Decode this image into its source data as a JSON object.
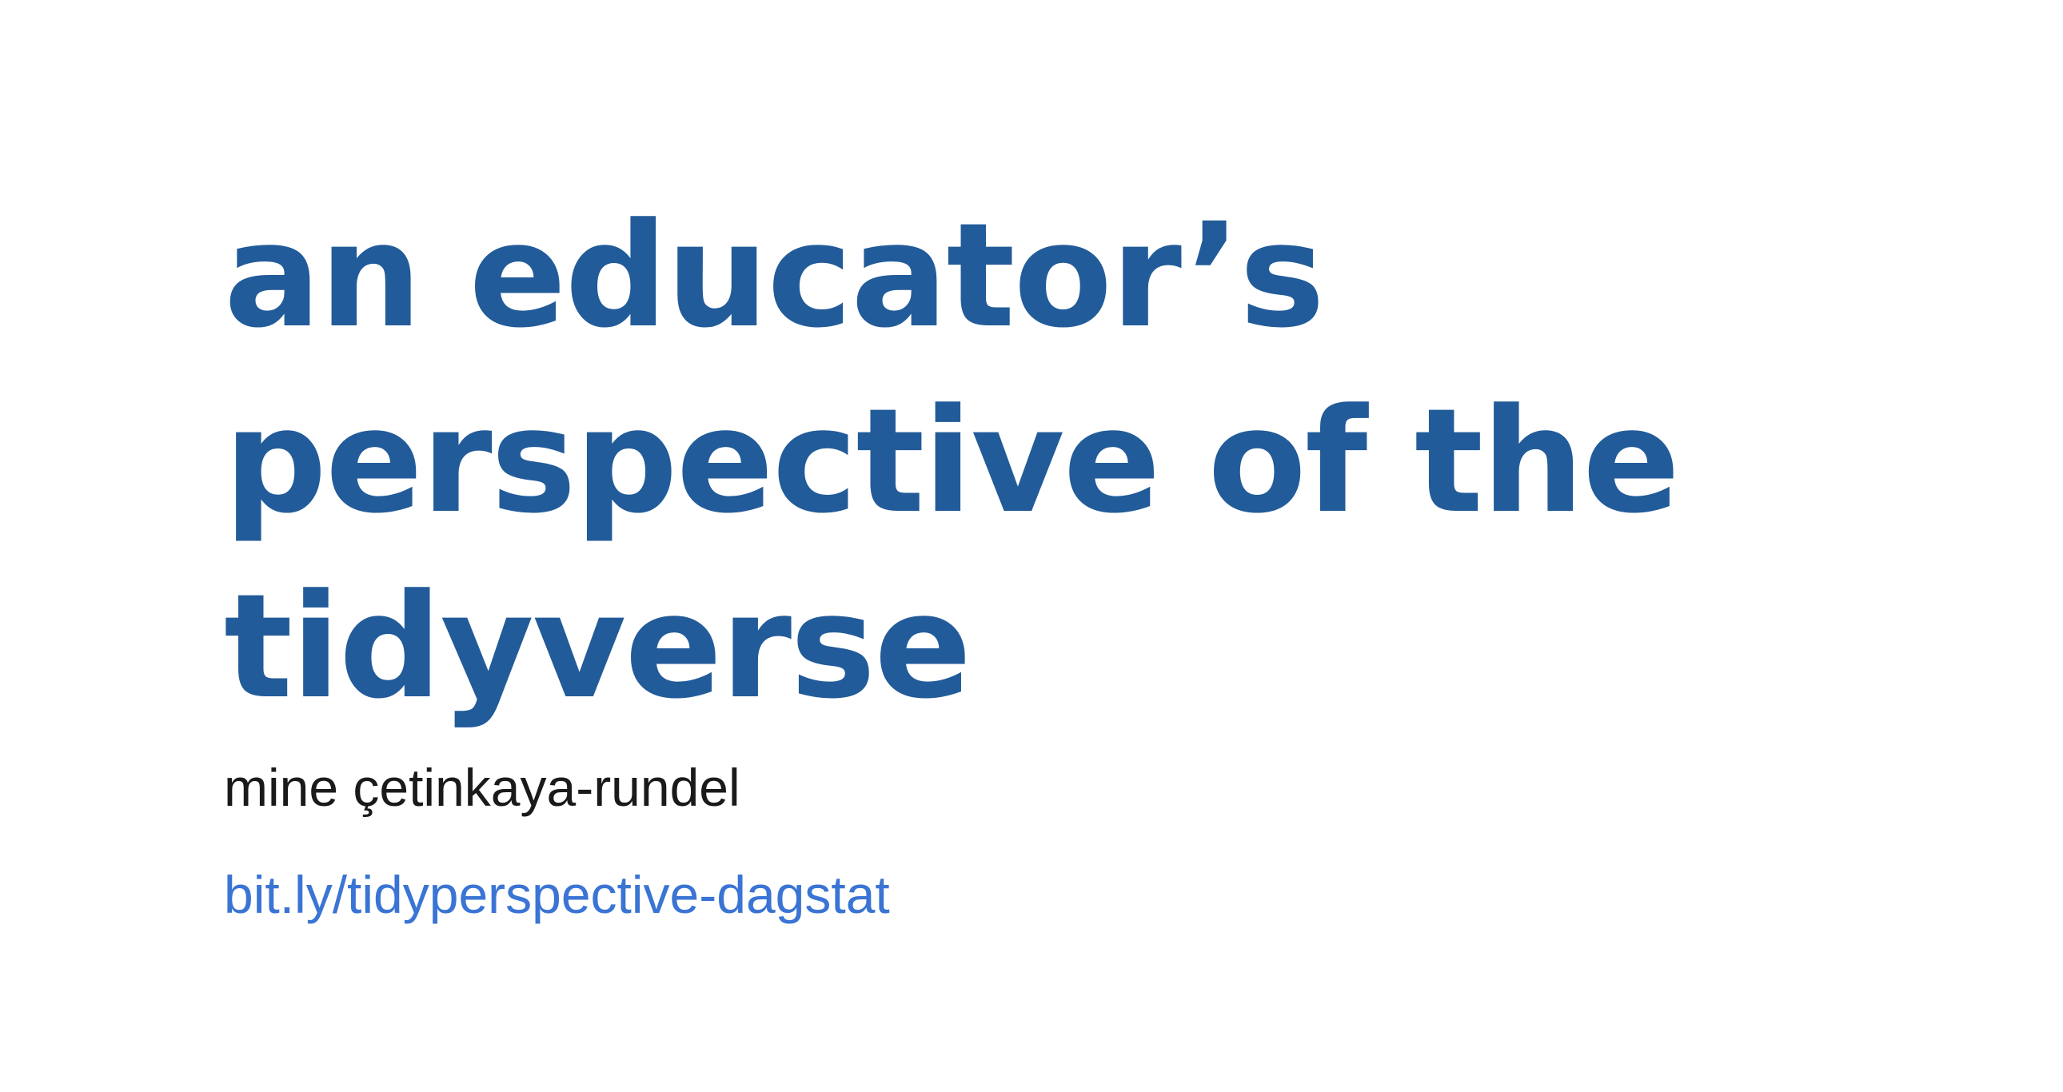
{
  "slide": {
    "title_lines": [
      "an educator’s",
      "perspective of the",
      "tidyverse"
    ],
    "author": "mine çetinkaya-rundel",
    "link_text": "bit.ly/tidyperspective-dagstat"
  },
  "colors": {
    "title": "#225b99",
    "author": "#1a1a1a",
    "link": "#3a74d4",
    "background": "#ffffff"
  }
}
